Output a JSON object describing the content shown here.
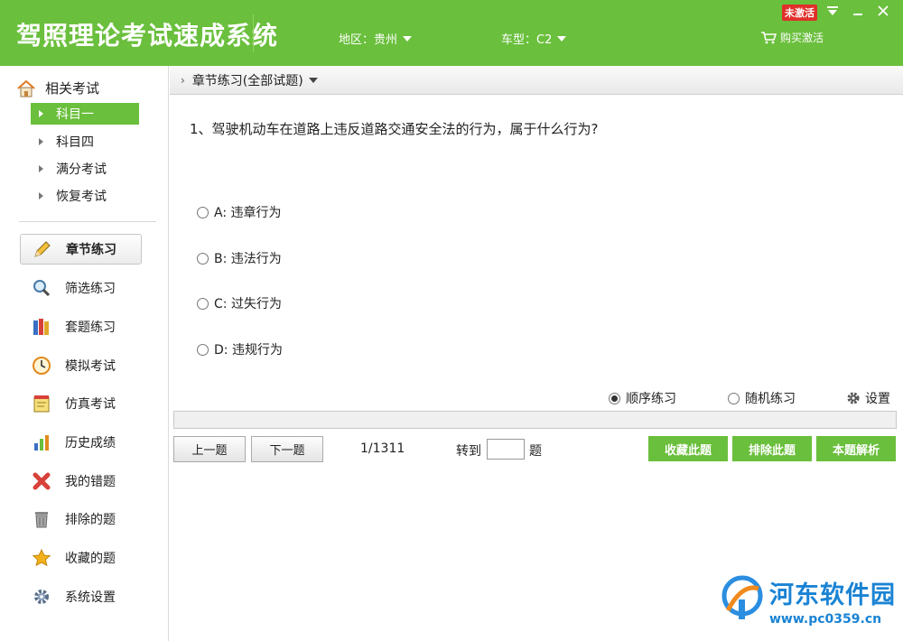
{
  "header": {
    "title": "驾照理论考试速成系统",
    "region_label": "地区：贵州",
    "car_type_label": "车型：C2",
    "buy_label": "购买激活",
    "inactive_badge": "未激活",
    "accent_color": "#6abf3c"
  },
  "sidebar": {
    "related_label": "相关考试",
    "subjects": [
      {
        "label": "科目一",
        "active": true
      },
      {
        "label": "科目四",
        "active": false
      },
      {
        "label": "满分考试",
        "active": false
      },
      {
        "label": "恢复考试",
        "active": false
      }
    ],
    "nav": [
      {
        "label": "章节练习",
        "icon": "pencil-icon",
        "active": true
      },
      {
        "label": "筛选练习",
        "icon": "magnifier-icon",
        "active": false
      },
      {
        "label": "套题练习",
        "icon": "books-icon",
        "active": false
      },
      {
        "label": "模拟考试",
        "icon": "clock-icon",
        "active": false
      },
      {
        "label": "仿真考试",
        "icon": "notepad-icon",
        "active": false
      },
      {
        "label": "历史成绩",
        "icon": "bar-chart-icon",
        "active": false
      },
      {
        "label": "我的错题",
        "icon": "red-x-icon",
        "active": false
      },
      {
        "label": "排除的题",
        "icon": "trash-icon",
        "active": false
      },
      {
        "label": "收藏的题",
        "icon": "star-icon",
        "active": false
      },
      {
        "label": "系统设置",
        "icon": "gear-icon",
        "active": false
      }
    ]
  },
  "main": {
    "breadcrumb": "章节练习(全部试题)",
    "question": "1、驾驶机动车在道路上违反道路交通安全法的行为，属于什么行为?",
    "options": [
      {
        "label": "A: 违章行为"
      },
      {
        "label": "B: 违法行为"
      },
      {
        "label": "C: 过失行为"
      },
      {
        "label": "D: 违规行为"
      }
    ],
    "mode_sequential": "顺序练习",
    "mode_random": "随机练习",
    "mode_selected": "sequential",
    "settings_label": "设置",
    "progress": 0,
    "prev_label": "上一题",
    "next_label": "下一题",
    "counter": "1/1311",
    "goto_label": "转到",
    "goto_value": "",
    "goto_suffix": "题",
    "favorite_label": "收藏此题",
    "exclude_label": "排除此题",
    "explain_label": "本题解析"
  },
  "watermark": {
    "name": "河东软件园",
    "url": "www.pc0359.cn"
  }
}
